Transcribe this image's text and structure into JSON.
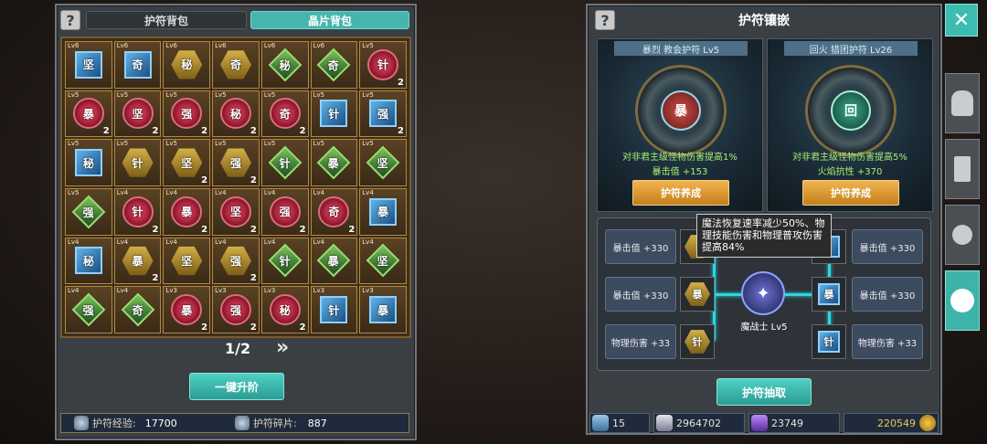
{
  "left": {
    "help": "?",
    "tabs": [
      {
        "label": "护符背包",
        "active": false
      },
      {
        "label": "晶片背包",
        "active": true
      }
    ],
    "grid": [
      [
        {
          "lv": "Lv6",
          "c": "坚",
          "t": "blue",
          "n": ""
        },
        {
          "lv": "Lv6",
          "c": "奇",
          "t": "blue",
          "n": ""
        },
        {
          "lv": "Lv6",
          "c": "秘",
          "t": "gold",
          "n": ""
        },
        {
          "lv": "Lv6",
          "c": "奇",
          "t": "gold",
          "n": ""
        },
        {
          "lv": "Lv6",
          "c": "秘",
          "t": "green",
          "n": ""
        },
        {
          "lv": "Lv6",
          "c": "奇",
          "t": "green",
          "n": ""
        },
        {
          "lv": "Lv5",
          "c": "针",
          "t": "red",
          "n": "2"
        }
      ],
      [
        {
          "lv": "Lv5",
          "c": "暴",
          "t": "red",
          "n": "2"
        },
        {
          "lv": "Lv5",
          "c": "坚",
          "t": "red",
          "n": "2"
        },
        {
          "lv": "Lv5",
          "c": "强",
          "t": "red",
          "n": "2"
        },
        {
          "lv": "Lv5",
          "c": "秘",
          "t": "red",
          "n": "2"
        },
        {
          "lv": "Lv5",
          "c": "奇",
          "t": "red",
          "n": "2"
        },
        {
          "lv": "Lv5",
          "c": "针",
          "t": "blue",
          "n": ""
        },
        {
          "lv": "Lv5",
          "c": "强",
          "t": "blue",
          "n": "2"
        }
      ],
      [
        {
          "lv": "Lv5",
          "c": "秘",
          "t": "blue",
          "n": ""
        },
        {
          "lv": "Lv5",
          "c": "针",
          "t": "gold",
          "n": ""
        },
        {
          "lv": "Lv5",
          "c": "坚",
          "t": "gold",
          "n": "2"
        },
        {
          "lv": "Lv5",
          "c": "强",
          "t": "gold",
          "n": "2"
        },
        {
          "lv": "Lv5",
          "c": "针",
          "t": "green",
          "n": ""
        },
        {
          "lv": "Lv5",
          "c": "暴",
          "t": "green",
          "n": ""
        },
        {
          "lv": "Lv5",
          "c": "坚",
          "t": "green",
          "n": ""
        }
      ],
      [
        {
          "lv": "Lv5",
          "c": "强",
          "t": "green",
          "n": ""
        },
        {
          "lv": "Lv4",
          "c": "针",
          "t": "red",
          "n": "2"
        },
        {
          "lv": "Lv4",
          "c": "暴",
          "t": "red",
          "n": "2"
        },
        {
          "lv": "Lv4",
          "c": "坚",
          "t": "red",
          "n": "2"
        },
        {
          "lv": "Lv4",
          "c": "强",
          "t": "red",
          "n": "2"
        },
        {
          "lv": "Lv4",
          "c": "奇",
          "t": "red",
          "n": "2"
        },
        {
          "lv": "Lv4",
          "c": "暴",
          "t": "blue",
          "n": ""
        }
      ],
      [
        {
          "lv": "Lv4",
          "c": "秘",
          "t": "blue",
          "n": ""
        },
        {
          "lv": "Lv4",
          "c": "暴",
          "t": "gold",
          "n": "2"
        },
        {
          "lv": "Lv4",
          "c": "坚",
          "t": "gold",
          "n": ""
        },
        {
          "lv": "Lv4",
          "c": "强",
          "t": "gold",
          "n": "2"
        },
        {
          "lv": "Lv4",
          "c": "针",
          "t": "green",
          "n": ""
        },
        {
          "lv": "Lv4",
          "c": "暴",
          "t": "green",
          "n": ""
        },
        {
          "lv": "Lv4",
          "c": "坚",
          "t": "green",
          "n": ""
        }
      ],
      [
        {
          "lv": "Lv4",
          "c": "强",
          "t": "green",
          "n": ""
        },
        {
          "lv": "Lv4",
          "c": "奇",
          "t": "green",
          "n": ""
        },
        {
          "lv": "Lv3",
          "c": "暴",
          "t": "red",
          "n": "2"
        },
        {
          "lv": "Lv3",
          "c": "强",
          "t": "red",
          "n": "2"
        },
        {
          "lv": "Lv3",
          "c": "秘",
          "t": "red",
          "n": "2"
        },
        {
          "lv": "Lv3",
          "c": "针",
          "t": "blue",
          "n": ""
        },
        {
          "lv": "Lv3",
          "c": "暴",
          "t": "blue",
          "n": ""
        }
      ]
    ],
    "page": "1/2",
    "next_icon": "»",
    "upgrade_label": "一键升阶",
    "stats": [
      {
        "label": "护符经验:",
        "value": "17700"
      },
      {
        "label": "护符碎片:",
        "value": "887"
      }
    ]
  },
  "right": {
    "help": "?",
    "title": "护符镶嵌",
    "charms": [
      {
        "name": "暴烈 教会护符 Lv5",
        "glyph": "暴",
        "effects": [
          "对非君主级怪物伤害提高1%",
          "暴击值 +153"
        ],
        "button": "护符养成"
      },
      {
        "name": "回火 猎团护符 Lv26",
        "glyph": "回",
        "effects": [
          "对非君主级怪物伤害提高5%",
          "火焰抗性 +370"
        ],
        "button": "护符养成"
      }
    ],
    "slots_left": [
      "暴击值 +330",
      "暴击值 +330",
      "物理伤害 +33"
    ],
    "slots_right": [
      "暴击值 +330",
      "暴击值 +330",
      "物理伤害 +33"
    ],
    "sockets_left": [
      "",
      "暴",
      "针"
    ],
    "sockets_right": [
      "",
      "暴",
      "针"
    ],
    "core_label": "魔战士 Lv5",
    "tooltip": "魔法恢复速率减少50%、物理技能伤害和物理普攻伤害提高84%",
    "extract_label": "护符抽取",
    "currencies": [
      "15",
      "2964702",
      "23749",
      "220549"
    ]
  },
  "close_icon": "✕",
  "side_tabs": [
    "helmet-icon",
    "weapons-icon",
    "lantern-icon",
    "gear-badge-icon"
  ]
}
